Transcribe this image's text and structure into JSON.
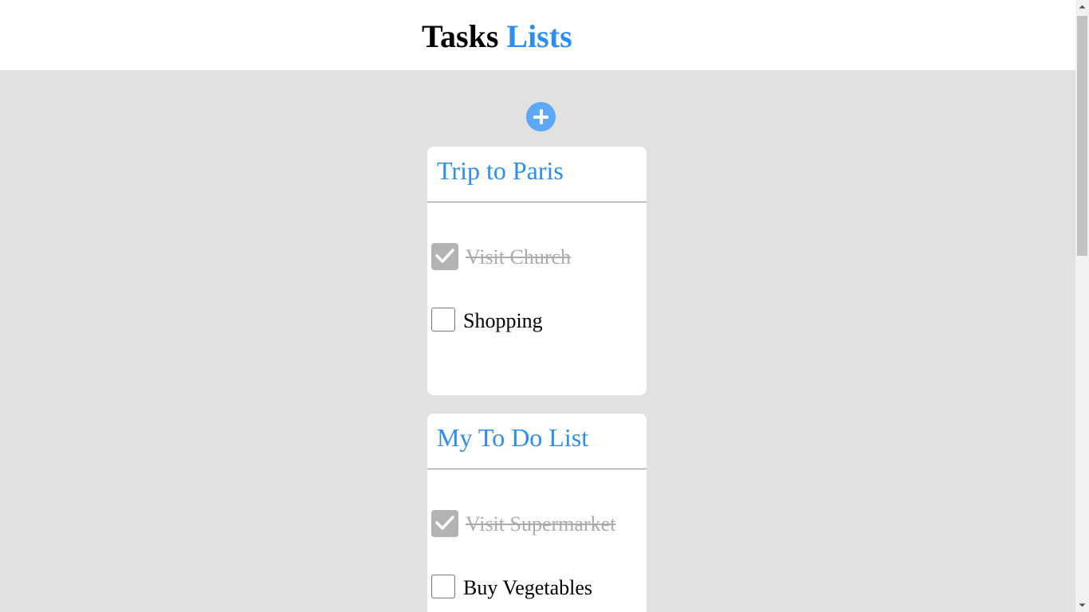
{
  "header": {
    "title_part1": "Tasks ",
    "title_part2": "Lists"
  },
  "add_button": {
    "icon": "plus-icon"
  },
  "lists": [
    {
      "title": "Trip to Paris",
      "tasks": [
        {
          "label": "Visit Church",
          "done": true
        },
        {
          "label": "Shopping",
          "done": false
        }
      ]
    },
    {
      "title": "My To Do List",
      "tasks": [
        {
          "label": "Visit Supermarket",
          "done": true
        },
        {
          "label": "Buy Vegetables",
          "done": false
        }
      ]
    }
  ],
  "colors": {
    "accent": "#2b8ef0",
    "add_button": "#5aa8f7",
    "background": "#e2e1e0",
    "done_text": "#ababab",
    "checked_box": "#b3b3b3"
  },
  "scrollbar": {
    "icons": [
      "scroll-up-arrow-icon",
      "scroll-down-arrow-icon"
    ]
  }
}
